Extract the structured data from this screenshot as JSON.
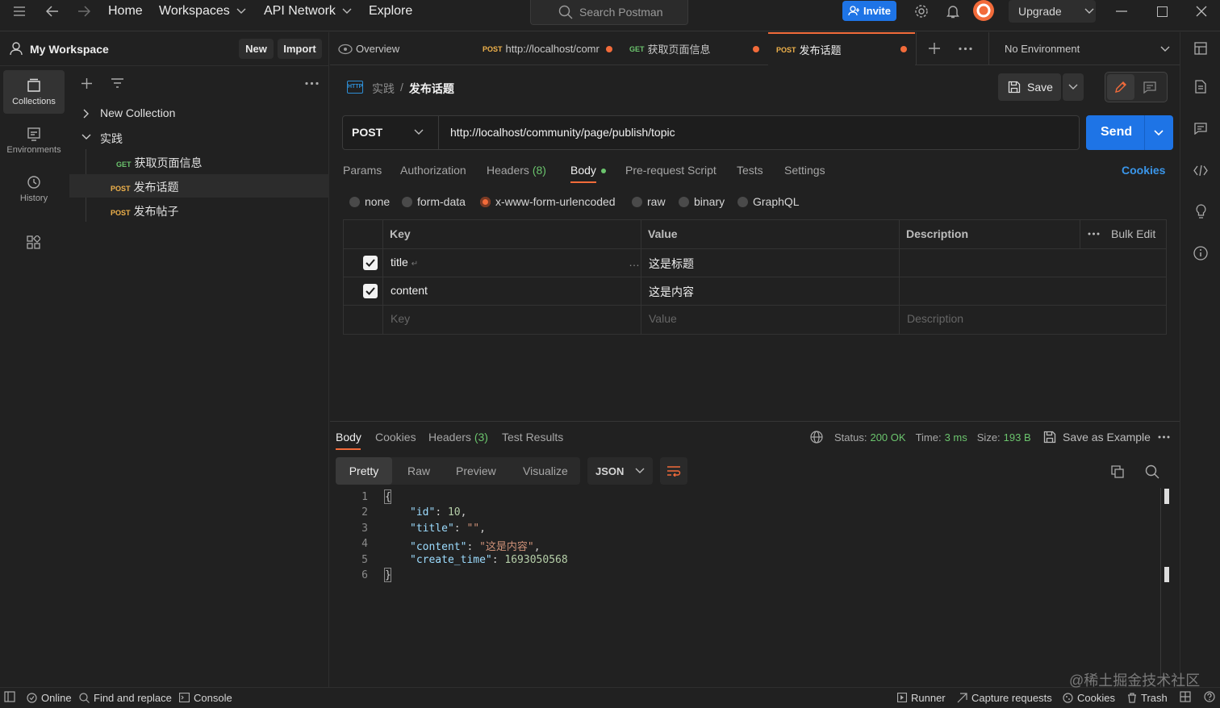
{
  "topbar": {
    "nav": [
      "Home",
      "Workspaces",
      "API Network",
      "Explore"
    ],
    "search_placeholder": "Search Postman",
    "invite_label": "Invite",
    "upgrade_label": "Upgrade"
  },
  "workspace": {
    "name": "My Workspace",
    "new_label": "New",
    "import_label": "Import"
  },
  "rail": {
    "items": [
      {
        "label": "Collections",
        "icon": "collections-icon"
      },
      {
        "label": "Environments",
        "icon": "environments-icon"
      },
      {
        "label": "History",
        "icon": "history-icon"
      }
    ]
  },
  "tree": {
    "collection1": "New Collection",
    "collection2": "实践",
    "requests": [
      {
        "method": "GET",
        "name": "获取页面信息"
      },
      {
        "method": "POST",
        "name": "发布话题"
      },
      {
        "method": "POST",
        "name": "发布帖子"
      }
    ]
  },
  "tabs": {
    "overview": "Overview",
    "items": [
      {
        "method": "POST",
        "name": "http://localhost/comr"
      },
      {
        "method": "GET",
        "name": "获取页面信息"
      },
      {
        "method": "POST",
        "name": "发布话题"
      }
    ],
    "environment": "No Environment"
  },
  "request": {
    "breadcrumb_parent": "实践",
    "breadcrumb_sep": "/",
    "breadcrumb_current": "发布话题",
    "save_label": "Save",
    "method": "POST",
    "url": "http://localhost/community/page/publish/topic",
    "send_label": "Send",
    "tabs": [
      "Params",
      "Authorization",
      "Headers",
      "(8)",
      "Body",
      "Pre-request Script",
      "Tests",
      "Settings"
    ],
    "cookies_label": "Cookies",
    "body_types": [
      "none",
      "form-data",
      "x-www-form-urlencoded",
      "raw",
      "binary",
      "GraphQL"
    ],
    "body_selected": "x-www-form-urlencoded",
    "table": {
      "headers": [
        "Key",
        "Value",
        "Description"
      ],
      "bulk_edit": "Bulk Edit",
      "rows": [
        {
          "key": "title",
          "value": "这是标题",
          "checked": true
        },
        {
          "key": "content",
          "value": "这是内容",
          "checked": true
        }
      ],
      "placeholders": {
        "key": "Key",
        "value": "Value",
        "description": "Description"
      }
    }
  },
  "response": {
    "tabs": [
      "Body",
      "Cookies",
      "Headers",
      "(3)",
      "Test Results"
    ],
    "status_label": "Status:",
    "status_value": "200 OK",
    "time_label": "Time:",
    "time_value": "3 ms",
    "size_label": "Size:",
    "size_value": "193 B",
    "save_example": "Save as Example",
    "view_modes": [
      "Pretty",
      "Raw",
      "Preview",
      "Visualize"
    ],
    "format": "JSON",
    "lines": [
      "1",
      "2",
      "3",
      "4",
      "5",
      "6"
    ],
    "code": {
      "open": "{",
      "k1": "\"id\"",
      "v1": "10",
      "k2": "\"title\"",
      "v2": "\"\"",
      "k3": "\"content\"",
      "v3": "\"这是内容\"",
      "k4": "\"create_time\"",
      "v4": "1693050568",
      "close": "}"
    }
  },
  "statusbar": {
    "online": "Online",
    "find": "Find and replace",
    "console": "Console",
    "runner": "Runner",
    "capture": "Capture requests",
    "cookies": "Cookies",
    "trash": "Trash"
  },
  "watermark": "@稀土掘金技术社区",
  "colors": {
    "accent": "#1e74e6",
    "orange": "#f26b3a",
    "get": "#6bc46d",
    "post": "#f0b24b",
    "success": "#6bc46d"
  }
}
